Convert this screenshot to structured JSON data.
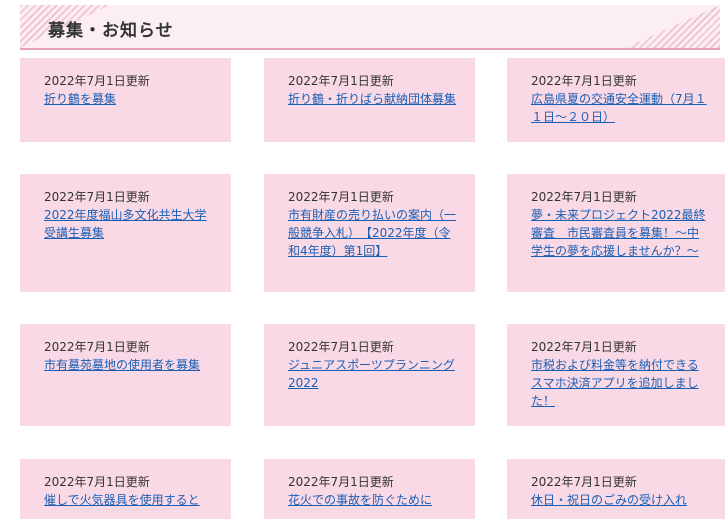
{
  "header": {
    "title": "募集・お知らせ"
  },
  "cards": [
    {
      "date": "2022年7月1日更新",
      "title": "折り鶴を募集"
    },
    {
      "date": "2022年7月1日更新",
      "title": "折り鶴・折りばら献納団体募集"
    },
    {
      "date": "2022年7月1日更新",
      "title": "広島県夏の交通安全運動（7月１１日～２０日）"
    },
    {
      "date": "2022年7月1日更新",
      "title": "2022年度福山多文化共生大学受講生募集"
    },
    {
      "date": "2022年7月1日更新",
      "title": "市有財産の売り払いの案内（一般競争入札）　【2022年度（令和4年度）第1回】"
    },
    {
      "date": "2022年7月1日更新",
      "title": "夢・未来プロジェクト2022最終審査　市民審査員を募集！～中学生の夢を応援しませんか？～"
    },
    {
      "date": "2022年7月1日更新",
      "title": "市有墓苑墓地の使用者を募集"
    },
    {
      "date": "2022年7月1日更新",
      "title": "ジュニアスポーツプランニング2022"
    },
    {
      "date": "2022年7月1日更新",
      "title": "市税および料金等を納付できるスマホ決済アプリを追加しました！"
    },
    {
      "date": "2022年7月1日更新",
      "title": "催しで火気器具を使用すると"
    },
    {
      "date": "2022年7月1日更新",
      "title": "花火での事故を防ぐために"
    },
    {
      "date": "2022年7月1日更新",
      "title": "休日・祝日のごみの受け入れ"
    }
  ]
}
